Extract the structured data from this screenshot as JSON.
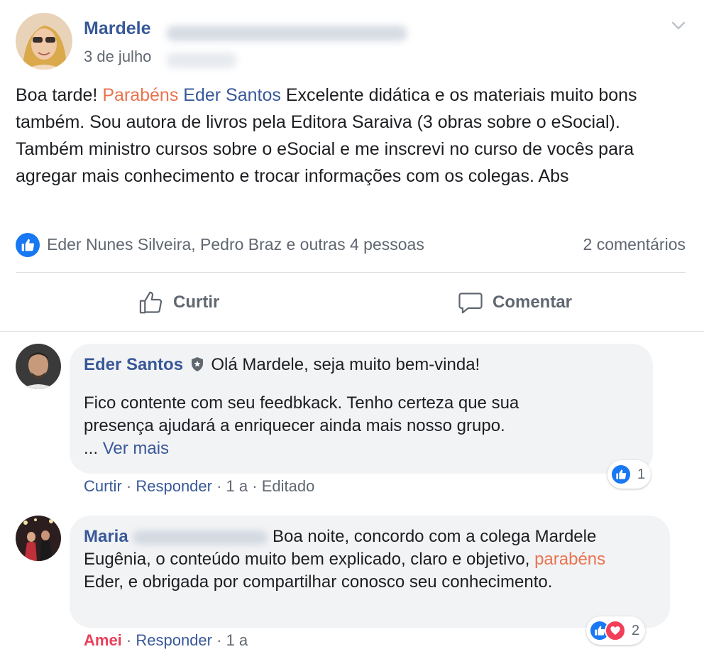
{
  "post": {
    "author_first": "Mardele",
    "date": "3 de julho",
    "body": {
      "p1": "Boa tarde! ",
      "p2": "Parabéns",
      "p3": "Eder Santos",
      "p4": " Excelente didática e os materiais muito bons também. Sou autora de livros pela Editora Saraiva (3 obras sobre o eSocial). Também ministro cursos sobre o eSocial e me inscrevi no curso de vocês para agregar mais conhecimento e trocar informações com os colegas. Abs"
    },
    "reactors": "Eder Nunes Silveira, Pedro Braz e outras 4 pessoas",
    "comments_count": "2 comentários",
    "actions": {
      "like": "Curtir",
      "comment": "Comentar"
    }
  },
  "comments": [
    {
      "author": "Eder Santos",
      "headline": "Olá Mardele, seja muito bem-vinda!",
      "line2": "Fico contente com seu feedbkack. Tenho certeza que sua",
      "line3": "presença ajudará a enriquecer ainda mais nosso grupo.",
      "ellipsis": "...",
      "see_more": "Ver mais",
      "meta": {
        "like": "Curtir",
        "reply": "Responder",
        "time": "1 a",
        "edited": "Editado",
        "sep": " · "
      },
      "reactions_count": "1"
    },
    {
      "author_first": "Maria",
      "text_a": "Boa noite, concordo com a colega Mardele Eugênia, o conteúdo muito bem explicado, claro e objetivo, ",
      "text_b": "parabéns",
      "text_c": " Eder, e obrigada por compartilhar conosco seu conhecimento.",
      "meta": {
        "loved": "Amei",
        "reply": "Responder",
        "time": "1 a",
        "sep": " · "
      },
      "reactions_count": "2"
    }
  ],
  "colors": {
    "link_blue": "#385898",
    "highlight_orange": "#e9734f",
    "like_blue": "#1877f2",
    "love_red": "#f33e58"
  }
}
